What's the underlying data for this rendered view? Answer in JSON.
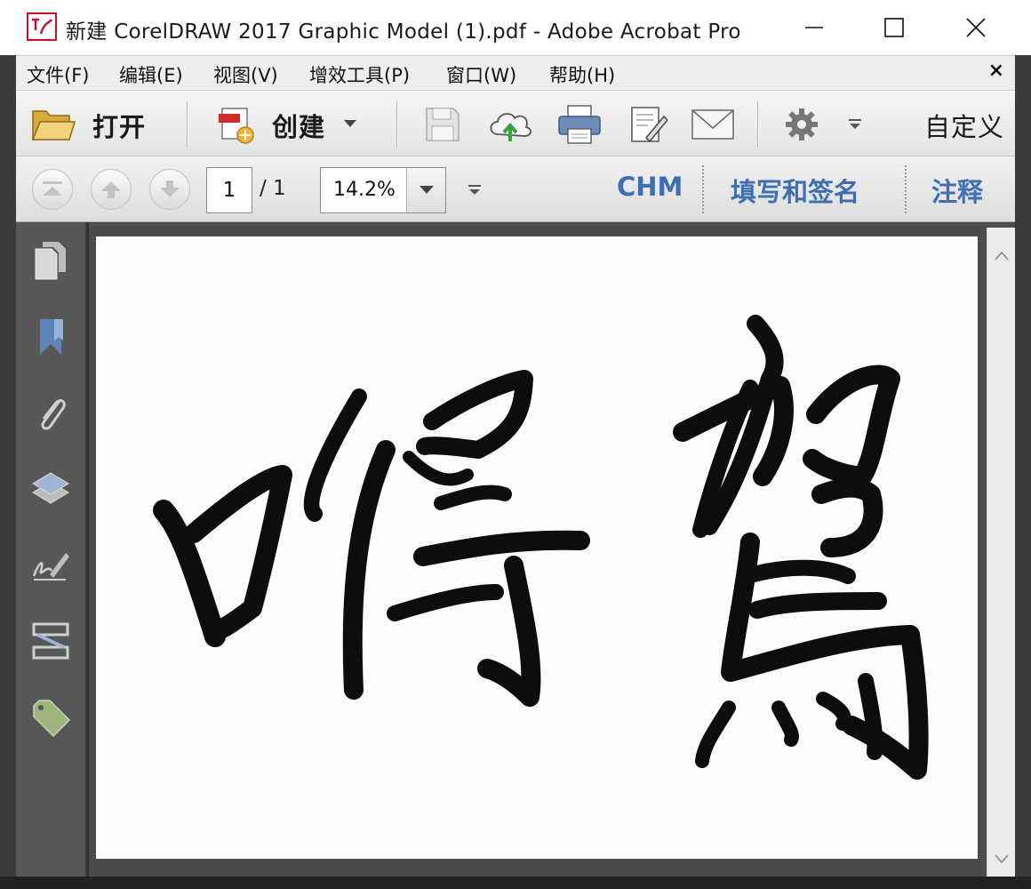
{
  "window": {
    "title": "新建 CorelDRAW 2017 Graphic Model (1).pdf - Adobe Acrobat Pro",
    "minimize_icon": "minimize-icon",
    "maximize_icon": "maximize-icon",
    "close_icon": "close-icon"
  },
  "menu": {
    "items": [
      "文件(F)",
      "编辑(E)",
      "视图(V)",
      "增效工具(P)",
      "窗口(W)",
      "帮助(H)"
    ],
    "close_label": "×"
  },
  "toolbar": {
    "open_label": "打开",
    "create_label": "创建",
    "customize_label": "自定义",
    "icons": [
      "folder-open-icon",
      "create-pdf-icon",
      "save-icon",
      "upload-cloud-icon",
      "print-icon",
      "edit-sign-icon",
      "email-icon",
      "gear-icon"
    ]
  },
  "navigation": {
    "current_page": "1",
    "total_pages": "/ 1",
    "zoom": "14.2%",
    "links": [
      "CHM",
      "填写和签名",
      "注释"
    ]
  },
  "side_panel": {
    "icons": [
      "pages-icon",
      "bookmark-icon",
      "attachment-icon",
      "layers-icon",
      "signature-icon",
      "content-icon",
      "tag-icon"
    ]
  },
  "document": {
    "content_description": "handwritten calligraphy",
    "glyphs": [
      "嘚",
      "駕"
    ]
  },
  "colors": {
    "accent_link": "#3f6fb0",
    "panel_bg": "#575757",
    "page_bg": "#fcfcfc"
  }
}
